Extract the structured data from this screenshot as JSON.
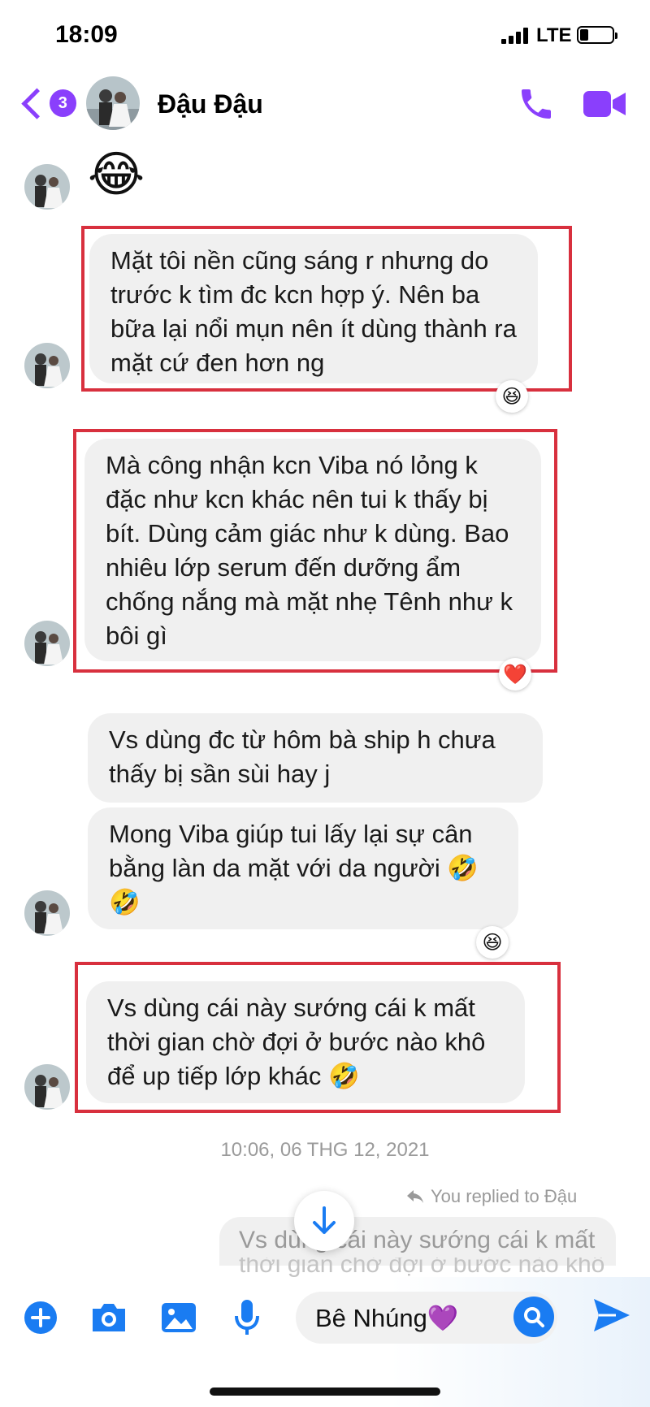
{
  "status_bar": {
    "time": "18:09",
    "network": "LTE"
  },
  "header": {
    "back_badge": "3",
    "contact_name": "Đậu Đậu"
  },
  "messages": [
    {
      "text": "😂"
    },
    {
      "text": "Mặt tôi nền cũng sáng r nhưng do trước k tìm đc kcn hợp ý. Nên ba bữa lại nổi mụn nên ít dùng thành ra mặt cứ đen hơn ng",
      "reaction": "😆"
    },
    {
      "text": "Mà công nhận kcn Viba nó lỏng k đặc như kcn khác nên tui k thấy bị bít. Dùng cảm giác như k dùng. Bao nhiêu lớp serum đến dưỡng ẩm chống nắng mà mặt nhẹ Tênh như k bôi gì",
      "reaction": "❤️"
    },
    {
      "text": "Vs dùng đc từ hôm bà ship h chưa thấy bị sần sùi hay j"
    },
    {
      "text": "Mong Viba giúp tui lấy lại sự cân bằng làn da mặt với da người 🤣 🤣",
      "reaction": "😆"
    },
    {
      "text": "Vs dùng cái này sướng cái k mất thời gian chờ đợi ở bước nào khô để up tiếp lớp khác 🤣"
    }
  ],
  "timestamp": "10:06, 06 THG 12, 2021",
  "replied_label": "You replied to Đậu",
  "reply_preview_line1": "Vs dùng cái này sướng cái k mất",
  "reply_preview_line2": "thời gian chờ đợi ở bước nào khô",
  "composer": {
    "input_text": "Bê Nhúng💜"
  },
  "colors": {
    "accent_purple": "#8a3ffc",
    "messenger_blue": "#1a7cf2",
    "highlight_red": "#d8303e",
    "bubble_gray": "#f0f0f0"
  }
}
